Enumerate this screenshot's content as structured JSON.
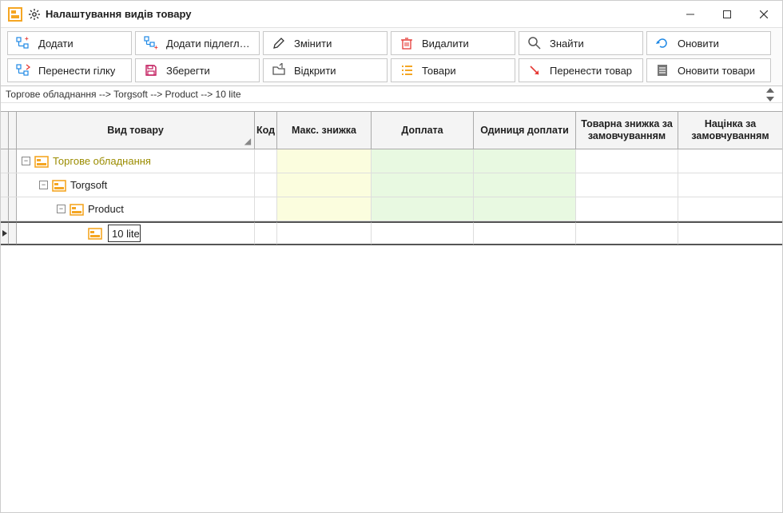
{
  "titlebar": {
    "title": "Налаштування видів товару"
  },
  "toolbar": {
    "row1": {
      "add": "Додати",
      "add_sub": "Додати підлеглий",
      "edit": "Змінити",
      "delete": "Видалити",
      "find": "Знайти",
      "refresh": "Оновити"
    },
    "row2": {
      "move_branch": "Перенести гілку",
      "save": "Зберегти",
      "open": "Відкрити",
      "goods": "Товари",
      "move_good": "Перенести товар",
      "update_goods": "Оновити товари"
    }
  },
  "breadcrumb": "Торгове обладнання --> Torgsoft --> Product --> 10 lite",
  "columns": {
    "tree": "Вид товару",
    "code": "Код",
    "max_discount": "Макс. знижка",
    "extra_pay": "Доплата",
    "extra_unit": "Одиниця доплати",
    "default_discount": "Товарна знижка за замовчуванням",
    "default_markup": "Націнка за замовчуванням"
  },
  "tree": {
    "root": {
      "label": "Торгове обладнання",
      "level": 0,
      "expanded": true
    },
    "n1": {
      "label": "Torgsoft",
      "level": 1,
      "expanded": true
    },
    "n2": {
      "label": "Product",
      "level": 2,
      "expanded": true
    },
    "n3": {
      "label": "10 lite",
      "level": 3,
      "expanded": false,
      "selected": true
    }
  }
}
